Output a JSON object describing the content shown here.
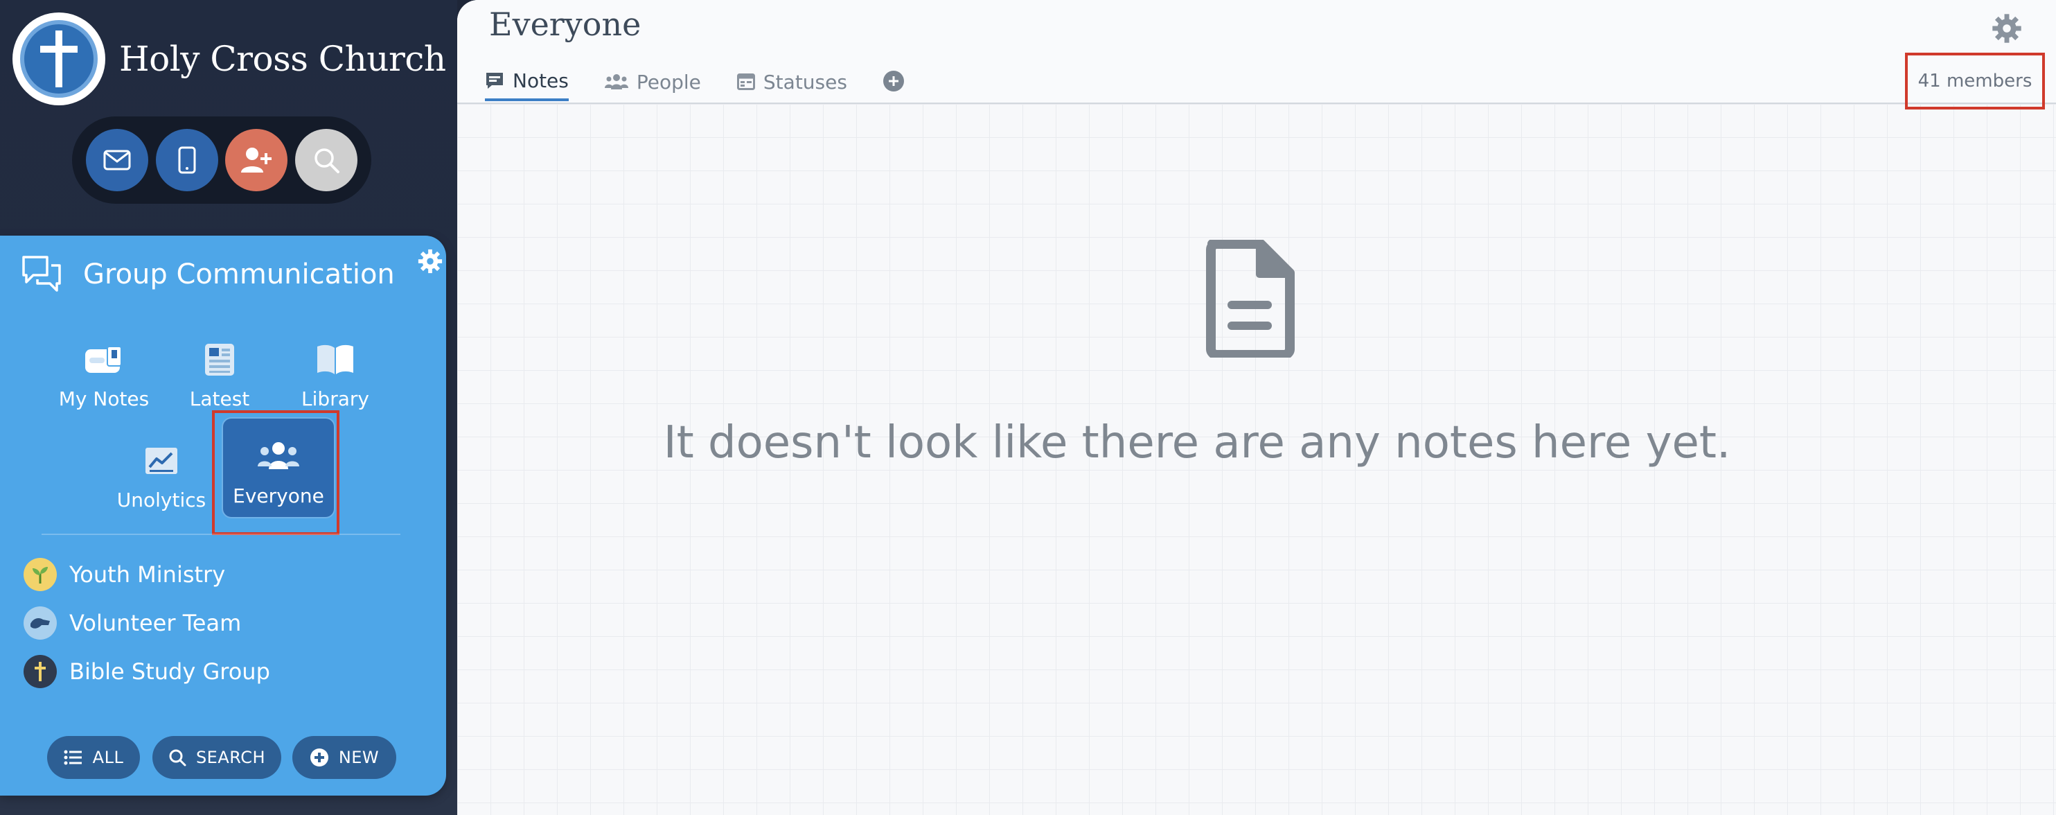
{
  "org": {
    "name": "Holy Cross Church"
  },
  "quick_actions": {
    "icons": [
      "envelope-icon",
      "mobile-phone-icon",
      "add-user-icon",
      "magnifier-icon"
    ]
  },
  "group_panel": {
    "title": "Group Communication",
    "tiles": [
      {
        "label": "My Notes",
        "icon": "notes-icon"
      },
      {
        "label": "Latest",
        "icon": "newspaper-icon"
      },
      {
        "label": "Library",
        "icon": "book-icon"
      },
      {
        "label": "Unolytics",
        "icon": "chart-icon"
      },
      {
        "label": "Everyone",
        "icon": "people-icon",
        "active": true
      }
    ],
    "groups": [
      {
        "label": "Youth Ministry",
        "icon": "sprout-icon",
        "color": "#f2d36b"
      },
      {
        "label": "Volunteer Team",
        "icon": "hand-icon",
        "color": "#a9d0ee"
      },
      {
        "label": "Bible Study Group",
        "icon": "cross-icon",
        "color": "#2f3b4f"
      }
    ],
    "buttons": {
      "all": "ALL",
      "search": "SEARCH",
      "new": "NEW"
    }
  },
  "main": {
    "title": "Everyone",
    "tabs": [
      {
        "label": "Notes",
        "icon": "note-bubble-icon",
        "active": true
      },
      {
        "label": "People",
        "icon": "people-icon"
      },
      {
        "label": "Statuses",
        "icon": "table-icon"
      }
    ],
    "member_count": "41 members",
    "empty_message": "It doesn't look like there are any notes here yet."
  },
  "colors": {
    "sidebar_bg": "#222b3f",
    "panel_bg": "#4ea6e8",
    "active_tile": "#2d6ab0",
    "highlight_red": "#d03a2c",
    "accent_blue": "#3c7fc6"
  }
}
